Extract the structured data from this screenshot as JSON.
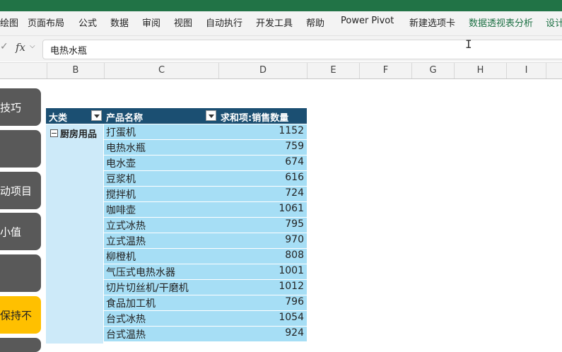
{
  "ribbon": {
    "tabs": [
      {
        "label": "绘图"
      },
      {
        "label": "页面布局"
      },
      {
        "label": "公式"
      },
      {
        "label": "数据"
      },
      {
        "label": "审阅"
      },
      {
        "label": "视图"
      },
      {
        "label": "自动执行"
      },
      {
        "label": "开发工具"
      },
      {
        "label": "帮助"
      },
      {
        "label": "Power Pivot"
      },
      {
        "label": "新建选项卡"
      },
      {
        "label": "数据透视表分析"
      },
      {
        "label": "设计"
      }
    ]
  },
  "formula_bar": {
    "fx_label": "fx",
    "content": "电热水瓶"
  },
  "columns": [
    "B",
    "C",
    "D",
    "E",
    "F",
    "G",
    "H",
    "I"
  ],
  "side_buttons": [
    {
      "label": "技巧"
    },
    {
      "label": ""
    },
    {
      "label": "动项目"
    },
    {
      "label": "小值"
    },
    {
      "label": ""
    },
    {
      "label": "保持不"
    }
  ],
  "pivot": {
    "headers": {
      "category": "大类",
      "product": "产品名称",
      "sum": "求和项:销售数量"
    },
    "category": "厨房用品",
    "rows": [
      {
        "name": "打蛋机",
        "value": "1152"
      },
      {
        "name": "电热水瓶",
        "value": "759"
      },
      {
        "name": "电水壶",
        "value": "674"
      },
      {
        "name": "豆浆机",
        "value": "616"
      },
      {
        "name": "搅拌机",
        "value": "724"
      },
      {
        "name": "咖啡壶",
        "value": "1061"
      },
      {
        "name": "立式冰热",
        "value": "795"
      },
      {
        "name": "立式温热",
        "value": "970"
      },
      {
        "name": "柳橙机",
        "value": "808"
      },
      {
        "name": "气压式电热水器",
        "value": "1001"
      },
      {
        "name": "切片切丝机/干磨机",
        "value": "1012"
      },
      {
        "name": "食品加工机",
        "value": "796"
      },
      {
        "name": "台式冰热",
        "value": "1054"
      },
      {
        "name": "台式温热",
        "value": "924"
      }
    ]
  }
}
